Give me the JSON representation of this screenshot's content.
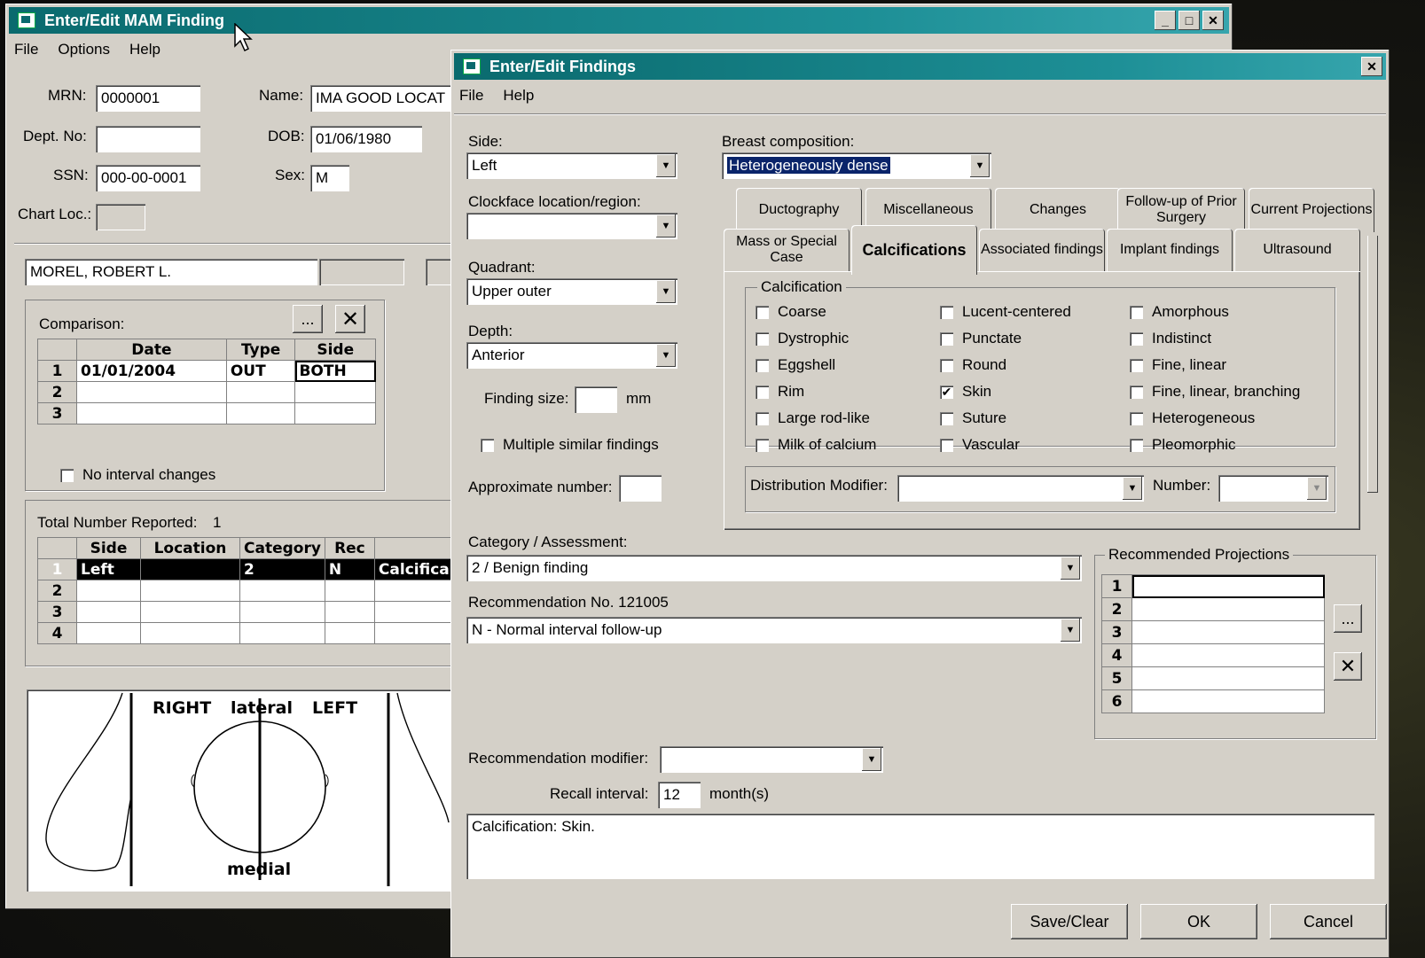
{
  "back_window": {
    "title": "Enter/Edit MAM Finding",
    "menu": [
      "File",
      "Options",
      "Help"
    ],
    "patient": {
      "mrn_label": "MRN:",
      "mrn": "0000001",
      "name_label": "Name:",
      "name": "IMA GOOD LOCAT",
      "dept_label": "Dept. No:",
      "dept": "",
      "dob_label": "DOB:",
      "dob": "01/06/1980",
      "ssn_label": "SSN:",
      "ssn": "000-00-0001",
      "sex_label": "Sex:",
      "sex": "M",
      "chart_label": "Chart Loc.:",
      "chart": ""
    },
    "physician": "MOREL, ROBERT L.",
    "comparison": {
      "label": "Comparison:",
      "more_label": "...",
      "columns": [
        "Date",
        "Type",
        "Side"
      ],
      "rows": [
        {
          "num": "1",
          "date": "01/01/2004",
          "type": "OUT",
          "side": "BOTH"
        },
        {
          "num": "2",
          "date": "",
          "type": "",
          "side": ""
        },
        {
          "num": "3",
          "date": "",
          "type": "",
          "side": ""
        }
      ],
      "no_interval": "No interval changes"
    },
    "findings": {
      "total_label": "Total Number Reported:",
      "total": "1",
      "columns": [
        "Side",
        "Location",
        "Category",
        "Rec"
      ],
      "rows": [
        {
          "num": "1",
          "side": "Left",
          "location": "",
          "category": "2",
          "rec": "N",
          "extra": "Calcifica"
        },
        {
          "num": "2",
          "side": "",
          "location": "",
          "category": "",
          "rec": "",
          "extra": ""
        },
        {
          "num": "3",
          "side": "",
          "location": "",
          "category": "",
          "rec": "",
          "extra": ""
        },
        {
          "num": "4",
          "side": "",
          "location": "",
          "category": "",
          "rec": "",
          "extra": ""
        }
      ]
    },
    "diagram": {
      "right": "RIGHT",
      "lateral": "lateral",
      "left": "LEFT",
      "medial": "medial"
    }
  },
  "front_window": {
    "title": "Enter/Edit Findings",
    "menu": [
      "File",
      "Help"
    ],
    "side_label": "Side:",
    "side": "Left",
    "clockface_label": "Clockface location/region:",
    "clockface": "",
    "quadrant_label": "Quadrant:",
    "quadrant": "Upper outer",
    "depth_label": "Depth:",
    "depth": "Anterior",
    "finding_size_label": "Finding size:",
    "finding_size": "",
    "finding_size_unit": "mm",
    "multiple_label": "Multiple similar findings",
    "approx_label": "Approximate number:",
    "approx": "",
    "breast_label": "Breast composition:",
    "breast": "Heterogeneously dense",
    "tabs_back": [
      "Ductography",
      "Miscellaneous",
      "Changes",
      "Follow-up of Prior Surgery",
      "Current Projections"
    ],
    "tabs_front": [
      "Mass or Special Case",
      "Calcifications",
      "Associated findings",
      "Implant findings",
      "Ultrasound"
    ],
    "calcification": {
      "group_label": "Calcification",
      "col1": [
        {
          "label": "Coarse",
          "checked": ""
        },
        {
          "label": "Dystrophic",
          "checked": ""
        },
        {
          "label": "Eggshell",
          "checked": ""
        },
        {
          "label": "Rim",
          "checked": ""
        },
        {
          "label": "Large rod-like",
          "checked": ""
        },
        {
          "label": "Milk of calcium",
          "checked": ""
        }
      ],
      "col2": [
        {
          "label": "Lucent-centered",
          "checked": ""
        },
        {
          "label": "Punctate",
          "checked": ""
        },
        {
          "label": "Round",
          "checked": ""
        },
        {
          "label": "Skin",
          "checked": "✔"
        },
        {
          "label": "Suture",
          "checked": ""
        },
        {
          "label": "Vascular",
          "checked": ""
        }
      ],
      "col3": [
        {
          "label": "Amorphous",
          "checked": ""
        },
        {
          "label": "Indistinct",
          "checked": ""
        },
        {
          "label": "Fine, linear",
          "checked": ""
        },
        {
          "label": "Fine, linear, branching",
          "checked": ""
        },
        {
          "label": "Heterogeneous",
          "checked": ""
        },
        {
          "label": "Pleomorphic",
          "checked": ""
        }
      ],
      "dist_label": "Distribution Modifier:",
      "dist": "",
      "number_label": "Number:",
      "number": ""
    },
    "category_label": "Category / Assessment:",
    "category": "2 / Benign finding",
    "recommendation_label": "Recommendation No. 121005",
    "recommendation": "N - Normal interval follow-up",
    "rec_proj": {
      "label": "Recommended Projections",
      "more_label": "...",
      "rows": [
        "1",
        "2",
        "3",
        "4",
        "5",
        "6"
      ]
    },
    "rec_modifier_label": "Recommendation modifier:",
    "rec_modifier": "",
    "recall_label": "Recall interval:",
    "recall": "12",
    "recall_unit": "month(s)",
    "notes": "Calcification:  Skin.",
    "buttons": {
      "save": "Save/Clear",
      "ok": "OK",
      "cancel": "Cancel"
    }
  }
}
